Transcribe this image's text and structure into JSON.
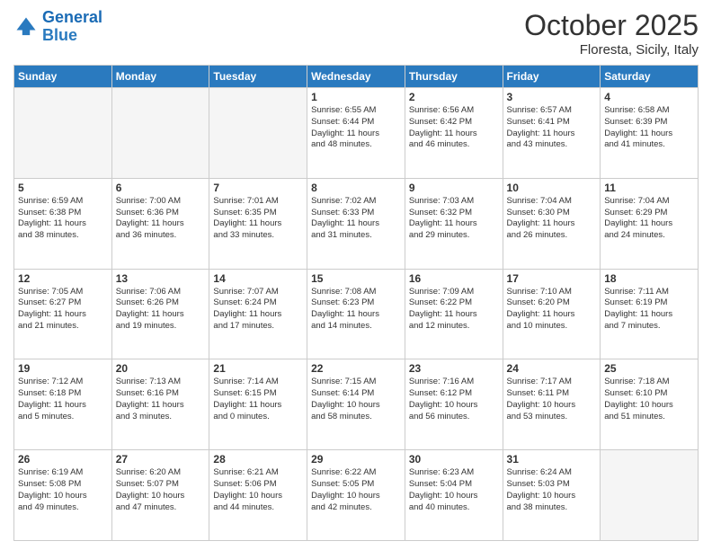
{
  "header": {
    "logo_general": "General",
    "logo_blue": "Blue",
    "month": "October 2025",
    "location": "Floresta, Sicily, Italy"
  },
  "days_of_week": [
    "Sunday",
    "Monday",
    "Tuesday",
    "Wednesday",
    "Thursday",
    "Friday",
    "Saturday"
  ],
  "weeks": [
    [
      {
        "day": "",
        "info": ""
      },
      {
        "day": "",
        "info": ""
      },
      {
        "day": "",
        "info": ""
      },
      {
        "day": "1",
        "info": "Sunrise: 6:55 AM\nSunset: 6:44 PM\nDaylight: 11 hours\nand 48 minutes."
      },
      {
        "day": "2",
        "info": "Sunrise: 6:56 AM\nSunset: 6:42 PM\nDaylight: 11 hours\nand 46 minutes."
      },
      {
        "day": "3",
        "info": "Sunrise: 6:57 AM\nSunset: 6:41 PM\nDaylight: 11 hours\nand 43 minutes."
      },
      {
        "day": "4",
        "info": "Sunrise: 6:58 AM\nSunset: 6:39 PM\nDaylight: 11 hours\nand 41 minutes."
      }
    ],
    [
      {
        "day": "5",
        "info": "Sunrise: 6:59 AM\nSunset: 6:38 PM\nDaylight: 11 hours\nand 38 minutes."
      },
      {
        "day": "6",
        "info": "Sunrise: 7:00 AM\nSunset: 6:36 PM\nDaylight: 11 hours\nand 36 minutes."
      },
      {
        "day": "7",
        "info": "Sunrise: 7:01 AM\nSunset: 6:35 PM\nDaylight: 11 hours\nand 33 minutes."
      },
      {
        "day": "8",
        "info": "Sunrise: 7:02 AM\nSunset: 6:33 PM\nDaylight: 11 hours\nand 31 minutes."
      },
      {
        "day": "9",
        "info": "Sunrise: 7:03 AM\nSunset: 6:32 PM\nDaylight: 11 hours\nand 29 minutes."
      },
      {
        "day": "10",
        "info": "Sunrise: 7:04 AM\nSunset: 6:30 PM\nDaylight: 11 hours\nand 26 minutes."
      },
      {
        "day": "11",
        "info": "Sunrise: 7:04 AM\nSunset: 6:29 PM\nDaylight: 11 hours\nand 24 minutes."
      }
    ],
    [
      {
        "day": "12",
        "info": "Sunrise: 7:05 AM\nSunset: 6:27 PM\nDaylight: 11 hours\nand 21 minutes."
      },
      {
        "day": "13",
        "info": "Sunrise: 7:06 AM\nSunset: 6:26 PM\nDaylight: 11 hours\nand 19 minutes."
      },
      {
        "day": "14",
        "info": "Sunrise: 7:07 AM\nSunset: 6:24 PM\nDaylight: 11 hours\nand 17 minutes."
      },
      {
        "day": "15",
        "info": "Sunrise: 7:08 AM\nSunset: 6:23 PM\nDaylight: 11 hours\nand 14 minutes."
      },
      {
        "day": "16",
        "info": "Sunrise: 7:09 AM\nSunset: 6:22 PM\nDaylight: 11 hours\nand 12 minutes."
      },
      {
        "day": "17",
        "info": "Sunrise: 7:10 AM\nSunset: 6:20 PM\nDaylight: 11 hours\nand 10 minutes."
      },
      {
        "day": "18",
        "info": "Sunrise: 7:11 AM\nSunset: 6:19 PM\nDaylight: 11 hours\nand 7 minutes."
      }
    ],
    [
      {
        "day": "19",
        "info": "Sunrise: 7:12 AM\nSunset: 6:18 PM\nDaylight: 11 hours\nand 5 minutes."
      },
      {
        "day": "20",
        "info": "Sunrise: 7:13 AM\nSunset: 6:16 PM\nDaylight: 11 hours\nand 3 minutes."
      },
      {
        "day": "21",
        "info": "Sunrise: 7:14 AM\nSunset: 6:15 PM\nDaylight: 11 hours\nand 0 minutes."
      },
      {
        "day": "22",
        "info": "Sunrise: 7:15 AM\nSunset: 6:14 PM\nDaylight: 10 hours\nand 58 minutes."
      },
      {
        "day": "23",
        "info": "Sunrise: 7:16 AM\nSunset: 6:12 PM\nDaylight: 10 hours\nand 56 minutes."
      },
      {
        "day": "24",
        "info": "Sunrise: 7:17 AM\nSunset: 6:11 PM\nDaylight: 10 hours\nand 53 minutes."
      },
      {
        "day": "25",
        "info": "Sunrise: 7:18 AM\nSunset: 6:10 PM\nDaylight: 10 hours\nand 51 minutes."
      }
    ],
    [
      {
        "day": "26",
        "info": "Sunrise: 6:19 AM\nSunset: 5:08 PM\nDaylight: 10 hours\nand 49 minutes."
      },
      {
        "day": "27",
        "info": "Sunrise: 6:20 AM\nSunset: 5:07 PM\nDaylight: 10 hours\nand 47 minutes."
      },
      {
        "day": "28",
        "info": "Sunrise: 6:21 AM\nSunset: 5:06 PM\nDaylight: 10 hours\nand 44 minutes."
      },
      {
        "day": "29",
        "info": "Sunrise: 6:22 AM\nSunset: 5:05 PM\nDaylight: 10 hours\nand 42 minutes."
      },
      {
        "day": "30",
        "info": "Sunrise: 6:23 AM\nSunset: 5:04 PM\nDaylight: 10 hours\nand 40 minutes."
      },
      {
        "day": "31",
        "info": "Sunrise: 6:24 AM\nSunset: 5:03 PM\nDaylight: 10 hours\nand 38 minutes."
      },
      {
        "day": "",
        "info": ""
      }
    ]
  ]
}
